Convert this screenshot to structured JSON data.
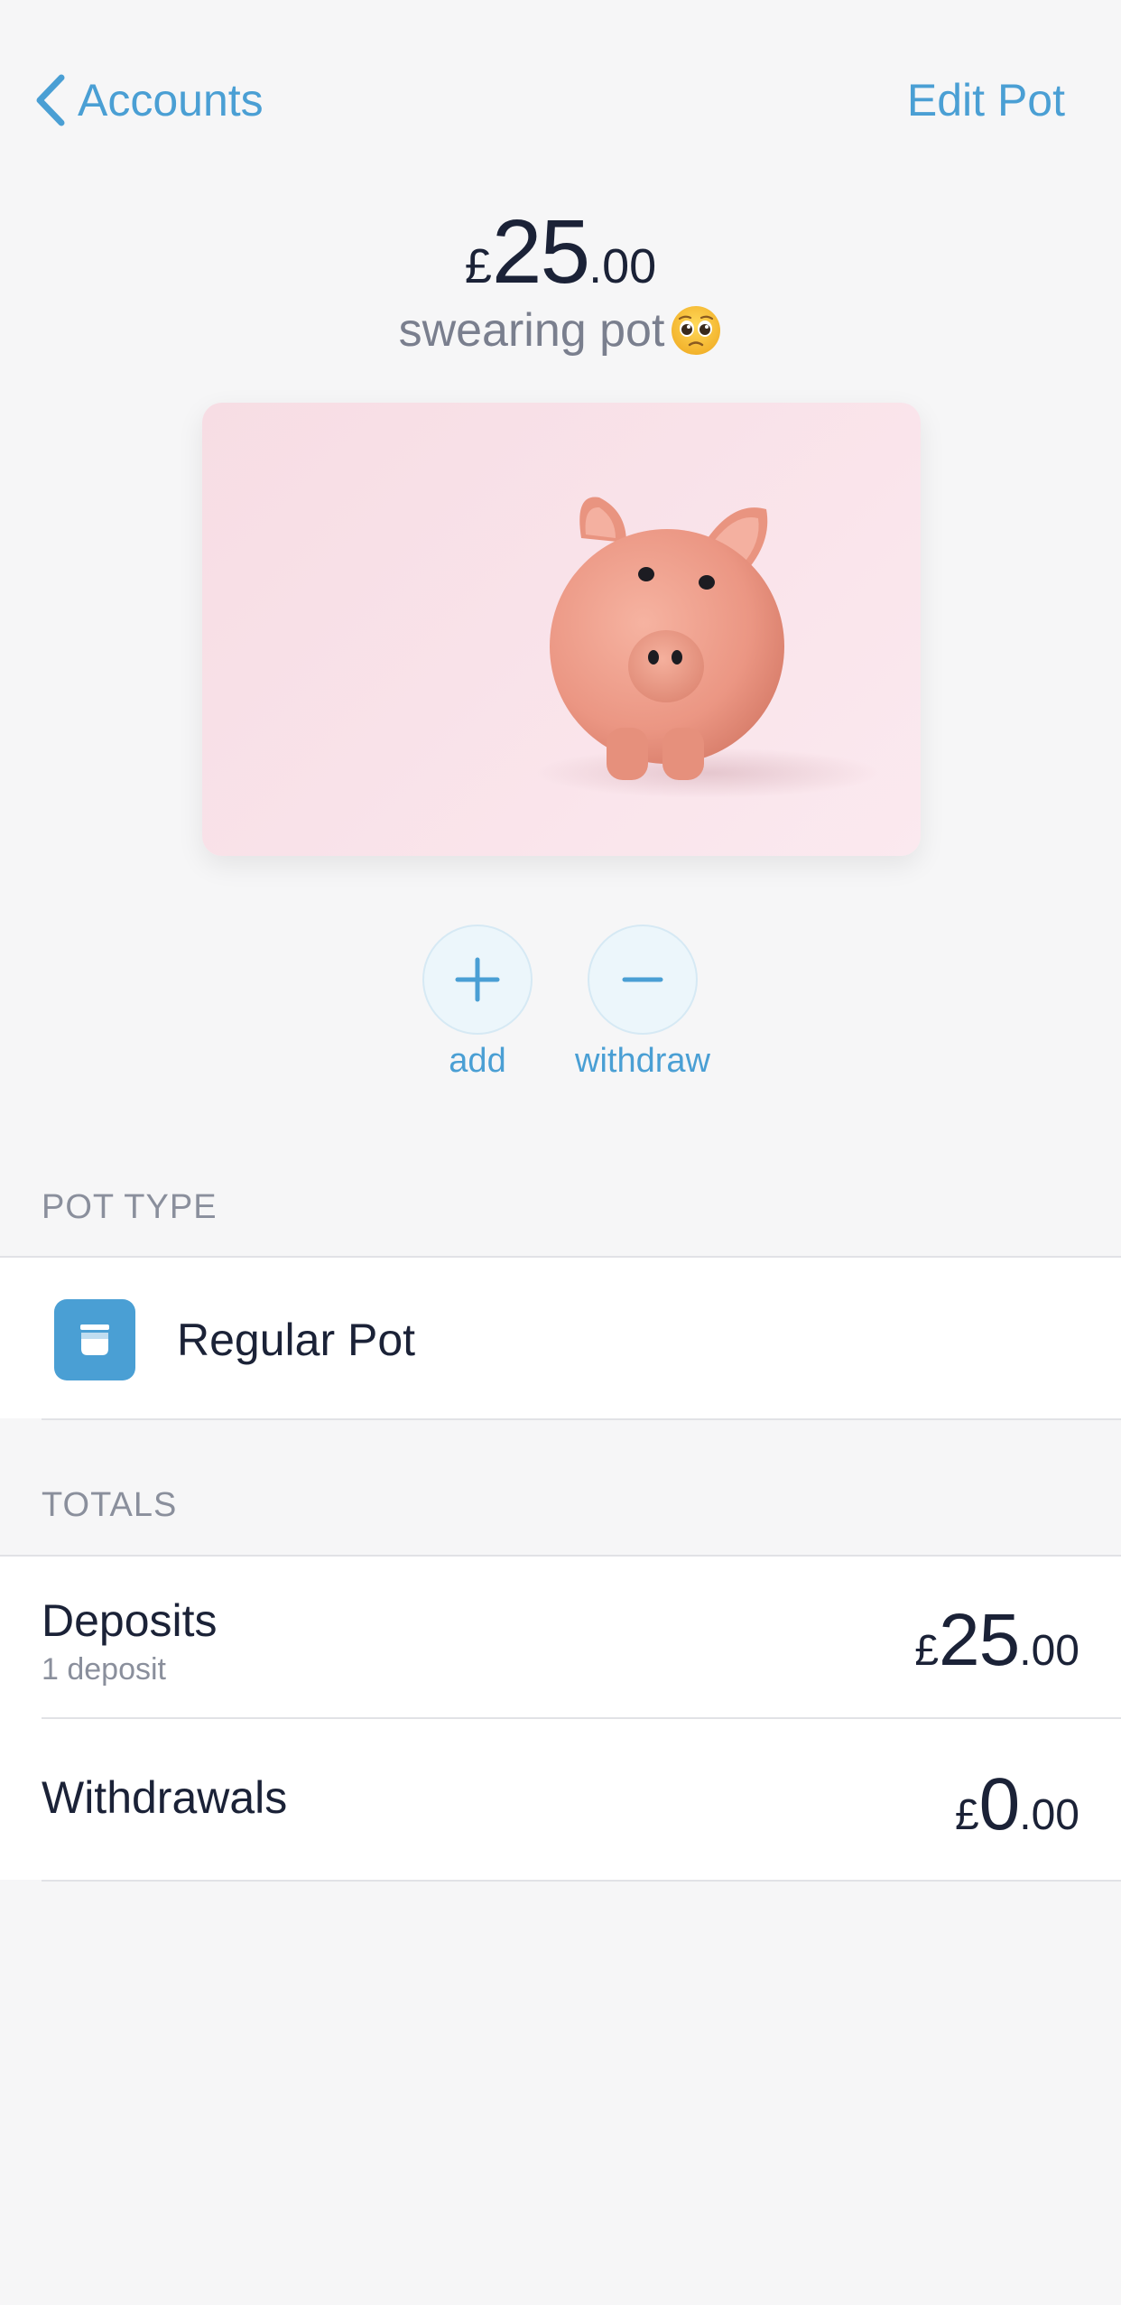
{
  "nav": {
    "back_label": "Accounts",
    "edit_label": "Edit Pot"
  },
  "balance": {
    "currency": "£",
    "major": "25",
    "minor": ".00"
  },
  "pot": {
    "name": "swearing pot"
  },
  "actions": {
    "add_label": "add",
    "withdraw_label": "withdraw"
  },
  "pot_type": {
    "header": "POT TYPE",
    "label": "Regular Pot"
  },
  "totals": {
    "header": "TOTALS",
    "deposits": {
      "label": "Deposits",
      "sub": "1 deposit",
      "currency": "£",
      "major": "25",
      "minor": ".00"
    },
    "withdrawals": {
      "label": "Withdrawals",
      "currency": "£",
      "major": "0",
      "minor": ".00"
    }
  },
  "colors": {
    "accent": "#4a9fd4",
    "text": "#1b2237",
    "muted": "#8a8f9c",
    "background": "#f6f6f7"
  },
  "icons": {
    "back": "chevron-left-icon",
    "emoji": "pleading-face-emoji",
    "add": "plus-icon",
    "withdraw": "minus-icon",
    "pot_type": "pot-icon"
  }
}
